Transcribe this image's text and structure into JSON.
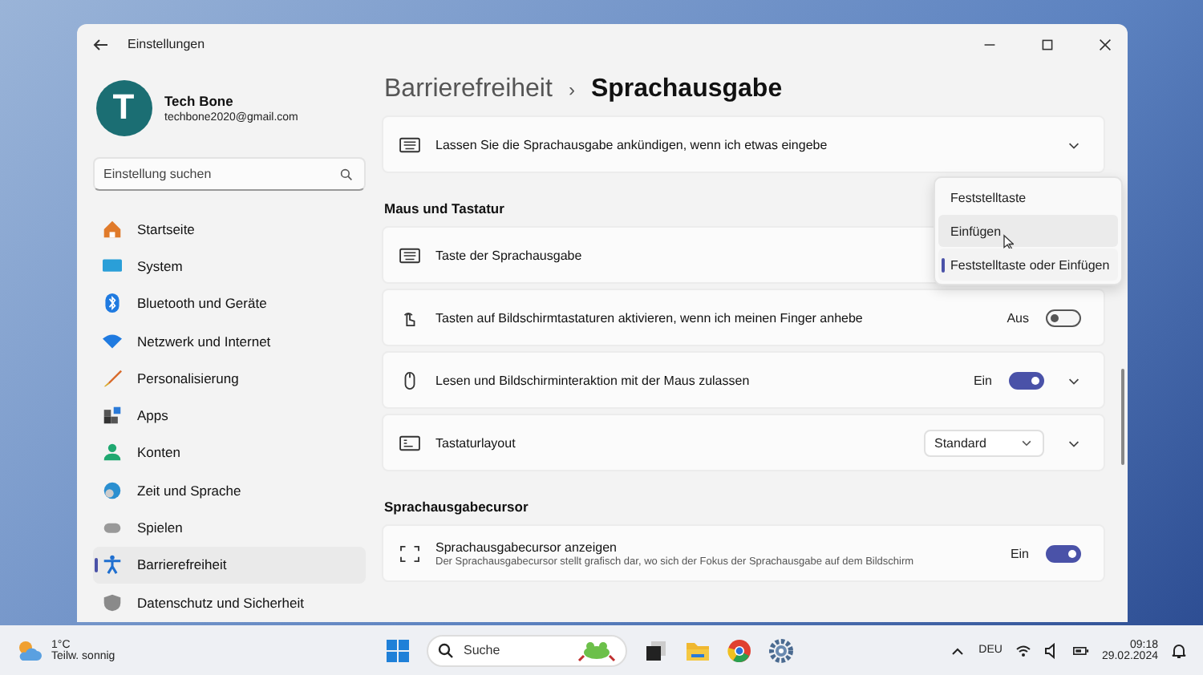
{
  "window": {
    "title": "Einstellungen"
  },
  "profile": {
    "initial": "T",
    "name": "Tech Bone",
    "email": "techbone2020@gmail.com"
  },
  "search": {
    "placeholder": "Einstellung suchen"
  },
  "sidebar": {
    "items": [
      {
        "label": "Startseite",
        "selected": false
      },
      {
        "label": "System",
        "selected": false
      },
      {
        "label": "Bluetooth und Geräte",
        "selected": false
      },
      {
        "label": "Netzwerk und Internet",
        "selected": false
      },
      {
        "label": "Personalisierung",
        "selected": false
      },
      {
        "label": "Apps",
        "selected": false
      },
      {
        "label": "Konten",
        "selected": false
      },
      {
        "label": "Zeit und Sprache",
        "selected": false
      },
      {
        "label": "Spielen",
        "selected": false
      },
      {
        "label": "Barrierefreiheit",
        "selected": true
      },
      {
        "label": "Datenschutz und Sicherheit",
        "selected": false
      }
    ]
  },
  "breadcrumb": {
    "parent": "Barrierefreiheit",
    "separator": "›",
    "current": "Sprachausgabe"
  },
  "sections": [
    {
      "cards": [
        {
          "kind": "expander",
          "label": "Lassen Sie die Sprachausgabe ankündigen, wenn ich etwas eingebe"
        }
      ]
    },
    {
      "heading": "Maus und Tastatur",
      "cards": [
        {
          "kind": "plain",
          "label": "Taste der Sprachausgabe"
        },
        {
          "kind": "toggle",
          "label": "Tasten auf Bildschirmtastaturen aktivieren, wenn ich meinen Finger anhebe",
          "state": "Aus",
          "on": false
        },
        {
          "kind": "toggle-expander",
          "label": "Lesen und Bildschirminteraktion mit der Maus zulassen",
          "state": "Ein",
          "on": true
        },
        {
          "kind": "select-expander",
          "label": "Tastaturlayout",
          "value": "Standard"
        }
      ]
    },
    {
      "heading": "Sprachausgabecursor",
      "cards": [
        {
          "kind": "toggle",
          "label": "Sprachausgabecursor anzeigen",
          "description": "Der Sprachausgabecursor stellt grafisch dar, wo sich der Fokus der Sprachausgabe auf dem Bildschirm",
          "state": "Ein",
          "on": true
        }
      ]
    }
  ],
  "dropdown": {
    "options": [
      {
        "label": "Feststelltaste",
        "selected": false,
        "hovered": false
      },
      {
        "label": "Einfügen",
        "selected": false,
        "hovered": true
      },
      {
        "label": "Feststelltaste oder Einfügen",
        "selected": true,
        "hovered": false
      }
    ]
  },
  "taskbar": {
    "weather": {
      "temp": "1°C",
      "condition": "Teilw. sonnig"
    },
    "search": {
      "placeholder": "Suche"
    },
    "language": "DEU",
    "time": "09:18",
    "date": "29.02.2024"
  }
}
